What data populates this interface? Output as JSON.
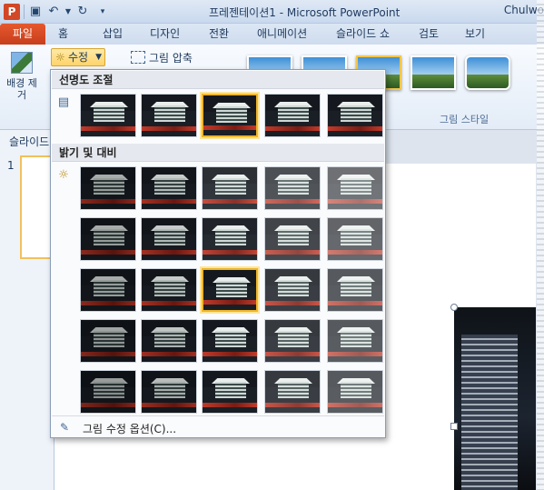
{
  "window": {
    "title": "프레젠테이션1 - Microsoft PowerPoint",
    "user": "Chulwo",
    "app_icon": "P"
  },
  "quick_access": {
    "save_icon": "save-icon",
    "undo_icon": "undo-icon",
    "undo_menu_icon": "chevron-down-icon",
    "redo_icon": "redo-icon",
    "customize_icon": "customize-toolbar-icon"
  },
  "tabs": {
    "file": "파일",
    "items": [
      "홈",
      "삽입",
      "디자인",
      "전환",
      "애니메이션",
      "슬라이드 쇼",
      "검토",
      "보기"
    ]
  },
  "ribbon": {
    "remove_background": "배경 제거",
    "corrections": "수정",
    "compress": "그림 압축",
    "picture_styles": "그림 스타일"
  },
  "slide_pane": {
    "title": "슬라이드",
    "slide_number": "1"
  },
  "dropdown": {
    "sharpen_title": "선명도 조절",
    "brightness_title": "밝기 및 대비",
    "sharpen_selected_index": 2,
    "brightness_selected": [
      2,
      2
    ],
    "footer_label": "그림 수정 옵션(C)...",
    "footer_icon": "picture-corrections-icon"
  },
  "colors": {
    "file_tab": "#d24726",
    "highlight": "#f0b52a",
    "accent": "#1e395b"
  }
}
